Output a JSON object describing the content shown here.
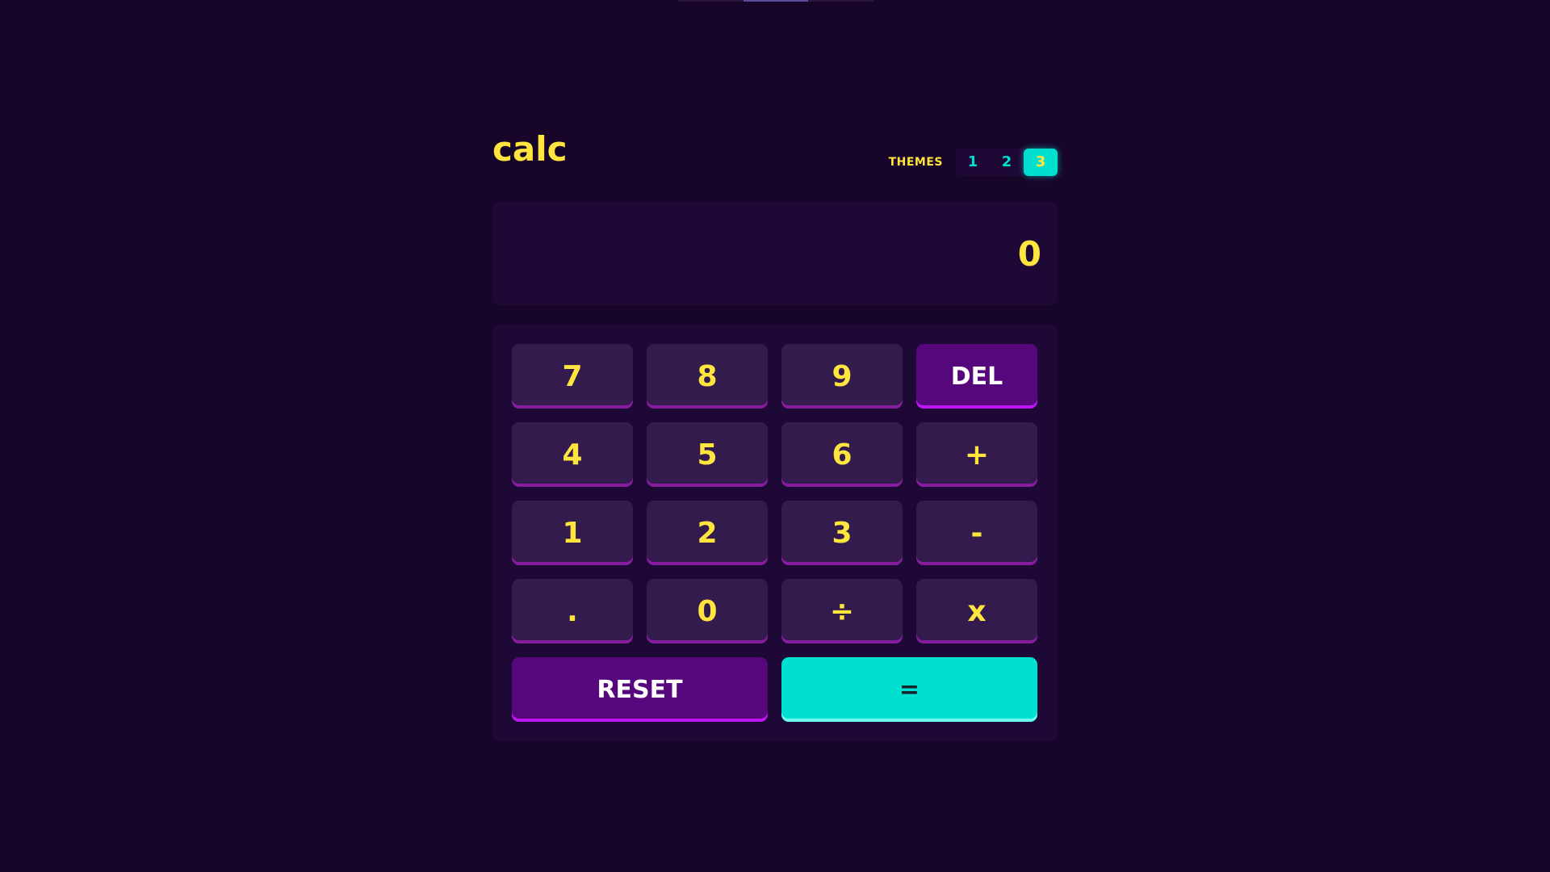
{
  "app": {
    "logo": "calc"
  },
  "themes": {
    "label": "THEMES",
    "options": [
      "1",
      "2",
      "3"
    ],
    "active": "3"
  },
  "display": {
    "value": "0"
  },
  "keys": {
    "k7": "7",
    "k8": "8",
    "k9": "9",
    "del": "DEL",
    "k4": "4",
    "k5": "5",
    "k6": "6",
    "plus": "+",
    "k1": "1",
    "k2": "2",
    "k3": "3",
    "minus": "-",
    "dot": ".",
    "k0": "0",
    "divide": "÷",
    "multiply": "x",
    "reset": "RESET",
    "equals": "="
  },
  "colors": {
    "background": "#17062a",
    "accent_yellow": "#ffe53d",
    "accent_cyan": "#00dece",
    "function_key": "#56077c"
  }
}
